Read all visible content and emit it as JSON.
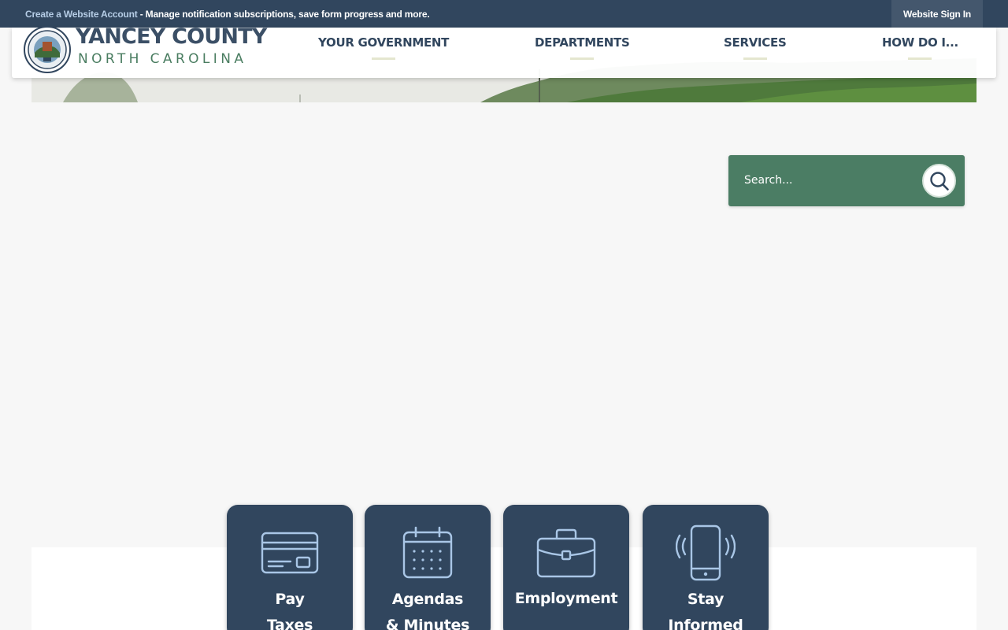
{
  "topbar": {
    "create_account_link": "Create a Website Account",
    "message": " - Manage notification subscriptions, save form progress and more.",
    "signin_label": "Website Sign In"
  },
  "brand": {
    "title": "YANCEY COUNTY",
    "subtitle": "NORTH CAROLINA"
  },
  "nav": {
    "items": [
      {
        "label": "YOUR GOVERNMENT"
      },
      {
        "label": "DEPARTMENTS"
      },
      {
        "label": "SERVICES"
      },
      {
        "label": "HOW DO I..."
      }
    ]
  },
  "search": {
    "placeholder": "Search..."
  },
  "quick_links": [
    {
      "label_line1": "Pay",
      "label_line2": "Taxes",
      "icon": "credit-card-icon"
    },
    {
      "label_line1": "Agendas",
      "label_line2": "& Minutes",
      "icon": "calendar-icon"
    },
    {
      "label_line1": "Employment",
      "label_line2": "",
      "icon": "briefcase-icon"
    },
    {
      "label_line1": "Stay",
      "label_line2": "Informed",
      "icon": "mobile-phone-icon"
    }
  ],
  "colors": {
    "navy": "#31465e",
    "green": "#4b7d64",
    "background": "#f7f7f7"
  }
}
